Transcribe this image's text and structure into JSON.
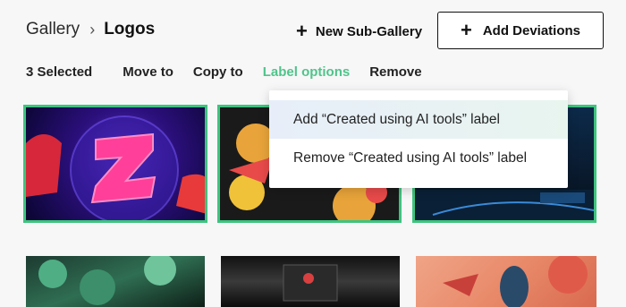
{
  "breadcrumb": {
    "root": "Gallery",
    "separator": "›",
    "current": "Logos"
  },
  "header": {
    "new_sub_gallery": "New Sub-Gallery",
    "add_deviations": "Add Deviations",
    "plus": "+"
  },
  "toolbar": {
    "selected_count": "3 Selected",
    "move_to": "Move to",
    "copy_to": "Copy to",
    "label_options": "Label options",
    "remove": "Remove"
  },
  "dropdown": {
    "items": [
      {
        "label": "Add “Created using AI tools” label"
      },
      {
        "label": "Remove “Created using AI tools” label"
      }
    ]
  },
  "thumbnails": [
    {
      "selected": true
    },
    {
      "selected": true
    },
    {
      "selected": true
    },
    {
      "selected": false
    },
    {
      "selected": false
    },
    {
      "selected": false
    }
  ],
  "colors": {
    "accent": "#3ec47e",
    "label_options_active": "#4fc48a"
  }
}
